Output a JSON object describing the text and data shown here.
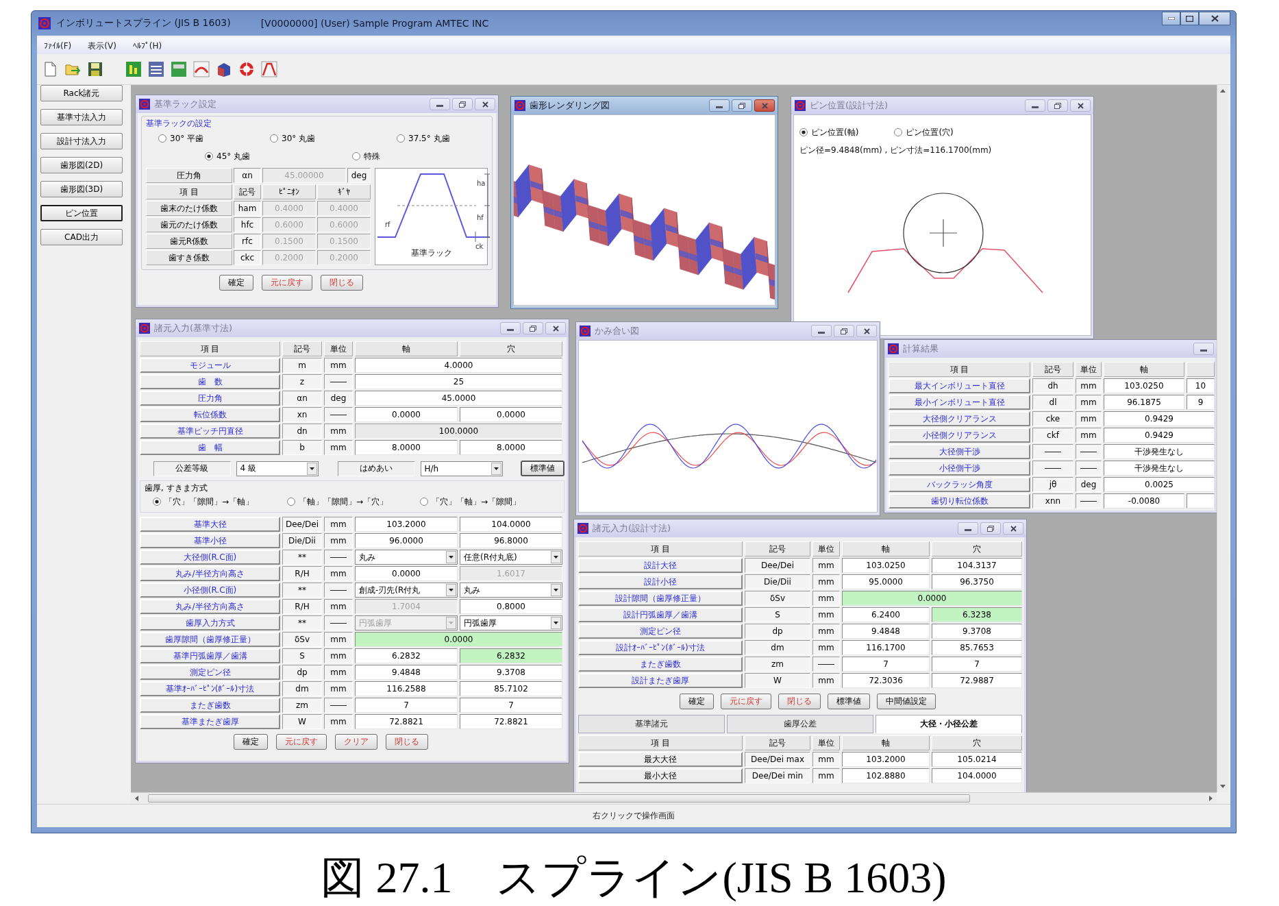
{
  "window": {
    "title": "インボリュートスプライン (JIS B 1603)",
    "subtitle": "[V0000000]  (User)  Sample Program  AMTEC INC"
  },
  "menu": [
    "ﾌｧｲﾙ(F)",
    "表示(V)",
    "ﾍﾙﾌﾟ(H)"
  ],
  "sidebar": [
    {
      "label": "Rack諸元",
      "selected": false
    },
    {
      "label": "基準寸法入力",
      "selected": false
    },
    {
      "label": "設計寸法入力",
      "selected": false
    },
    {
      "label": "歯形図(2D)",
      "selected": false
    },
    {
      "label": "歯形図(3D)",
      "selected": false
    },
    {
      "label": "ピン位置",
      "selected": true
    },
    {
      "label": "CAD出力",
      "selected": false
    }
  ],
  "windows": [
    {
      "kind": "rack",
      "title": "基準ラック設定",
      "active": false,
      "cut_off": false,
      "group_label": "基準ラックの設定",
      "radios": [
        {
          "label": "30° 平歯",
          "selected": false
        },
        {
          "label": "30° 丸歯",
          "selected": false
        },
        {
          "label": "37.5° 丸歯",
          "selected": false
        },
        {
          "label": "45° 丸歯",
          "selected": true
        },
        {
          "label": "特殊",
          "selected": false
        }
      ],
      "pressure_angle": {
        "label": "圧力角",
        "symbol": "αn",
        "value": "45.00000",
        "unit": "deg",
        "disabled": true
      },
      "columns": [
        "項 目",
        "記号",
        "ﾋﾟﾆｵﾝ",
        "ｷﾞﾔ"
      ],
      "rows": [
        {
          "label": "歯末のたけ係数",
          "symbol": "ham",
          "values": [
            "0.4000",
            "0.4000"
          ],
          "disabled": true
        },
        {
          "label": "歯元のたけ係数",
          "symbol": "hfc",
          "values": [
            "0.6000",
            "0.6000"
          ],
          "disabled": true
        },
        {
          "label": "歯元R係数",
          "symbol": "rfc",
          "values": [
            "0.1500",
            "0.1500"
          ],
          "disabled": true
        },
        {
          "label": "歯すき係数",
          "symbol": "ckc",
          "values": [
            "0.2000",
            "0.2000"
          ],
          "disabled": true
        }
      ],
      "diagram": {
        "labels": [
          "ha",
          "hf",
          "rf",
          "ck"
        ],
        "caption": "基準ラック"
      },
      "buttons": [
        {
          "label": "確定",
          "kind": "normal"
        },
        {
          "label": "元に戻す",
          "kind": "warn"
        },
        {
          "label": "閉じる",
          "kind": "warn"
        }
      ]
    },
    {
      "kind": "render",
      "title": "歯形レンダリング図",
      "active": true,
      "cut_off": false
    },
    {
      "kind": "pin",
      "title": "ピン位置(設計寸法)",
      "active": false,
      "cut_off": false,
      "radios": [
        {
          "label": "ピン位置(軸)",
          "selected": true
        },
        {
          "label": "ピン位置(穴)",
          "selected": false
        }
      ],
      "info": "ピン径=9.4848(mm) , ピン寸法=116.1700(mm)"
    },
    {
      "kind": "base_input",
      "title": "諸元入力(基準寸法)",
      "active": false,
      "cut_off": false,
      "columns": [
        "項 目",
        "記号",
        "単位",
        "軸",
        "穴"
      ],
      "rows": [
        {
          "label": "モジュール",
          "symbol": "m",
          "unit": "mm",
          "cells": [
            {
              "value": "4.0000",
              "kind": "field"
            }
          ]
        },
        {
          "label": "歯　数",
          "symbol": "z",
          "unit": "――",
          "cells": [
            {
              "value": "25",
              "kind": "field"
            }
          ]
        },
        {
          "label": "圧力角",
          "symbol": "αn",
          "unit": "deg",
          "cells": [
            {
              "value": "45.0000",
              "kind": "field"
            }
          ]
        },
        {
          "label": "転位係数",
          "symbol": "xn",
          "unit": "――",
          "cells": [
            {
              "value": "0.0000",
              "kind": "field"
            },
            {
              "value": "0.0000",
              "kind": "field"
            }
          ]
        },
        {
          "label": "基準ピッチ円直径",
          "symbol": "dn",
          "unit": "mm",
          "cells": [
            {
              "value": "100.0000",
              "kind": "readonly"
            }
          ]
        },
        {
          "label": "歯　幅",
          "symbol": "b",
          "unit": "mm",
          "cells": [
            {
              "value": "8.0000",
              "kind": "field"
            },
            {
              "value": "8.0000",
              "kind": "field"
            }
          ]
        }
      ],
      "tolerance": {
        "label": "公差等級",
        "grade": "4 級",
        "fit_label": "はめあい",
        "fit": "H/h",
        "button": "標準値"
      },
      "method": {
        "label": "歯厚, すきま方式",
        "options": [
          {
            "label": "「穴」「隙間」→「軸」",
            "selected": true
          },
          {
            "label": "「軸」「隙間」→「穴」",
            "selected": false
          },
          {
            "label": "「穴」「軸」→「隙間」",
            "selected": false
          }
        ]
      },
      "rows_2": [
        {
          "label": "基準大径",
          "symbol": "Dee/Dei",
          "unit": "mm",
          "cells": [
            {
              "value": "103.2000",
              "kind": "field"
            },
            {
              "value": "104.0000",
              "kind": "field"
            }
          ]
        },
        {
          "label": "基準小径",
          "symbol": "Die/Dii",
          "unit": "mm",
          "cells": [
            {
              "value": "96.0000",
              "kind": "field"
            },
            {
              "value": "96.8000",
              "kind": "field"
            }
          ]
        },
        {
          "label": "大径側(R.C面)",
          "symbol": "**",
          "unit": "――",
          "cells": [
            {
              "value": "丸み",
              "kind": "select"
            },
            {
              "value": "任意(R付丸底)",
              "kind": "select"
            }
          ]
        },
        {
          "label": "丸み/半径方向高さ",
          "symbol": "R/H",
          "unit": "mm",
          "cells": [
            {
              "value": "0.0000",
              "kind": "field"
            },
            {
              "value": "1.6017",
              "kind": "disabled"
            }
          ]
        },
        {
          "label": "小径側(R.C面)",
          "symbol": "**",
          "unit": "――",
          "cells": [
            {
              "value": "創成-刃先(R付丸",
              "kind": "select"
            },
            {
              "value": "丸み",
              "kind": "select"
            }
          ]
        },
        {
          "label": "丸み/半径方向高さ",
          "symbol": "R/H",
          "unit": "mm",
          "cells": [
            {
              "value": "1.7004",
              "kind": "disabled"
            },
            {
              "value": "0.8000",
              "kind": "field"
            }
          ]
        },
        {
          "label": "歯厚入力方式",
          "symbol": "**",
          "unit": "――",
          "cells": [
            {
              "value": "円弧歯厚",
              "kind": "select_disabled"
            },
            {
              "value": "円弧歯厚",
              "kind": "select"
            }
          ]
        },
        {
          "label": "歯厚隙間（歯厚修正量）",
          "symbol": "δSv",
          "unit": "mm",
          "cells": [
            {
              "value": "0.0000",
              "kind": "highlight"
            }
          ]
        },
        {
          "label": "基準円弧歯厚／歯溝",
          "symbol": "S",
          "unit": "mm",
          "cells": [
            {
              "value": "6.2832",
              "kind": "field"
            },
            {
              "value": "6.2832",
              "kind": "highlight"
            }
          ]
        },
        {
          "label": "測定ピン径",
          "symbol": "dp",
          "unit": "mm",
          "cells": [
            {
              "value": "9.4848",
              "kind": "field"
            },
            {
              "value": "9.3708",
              "kind": "field"
            }
          ]
        },
        {
          "label": "基準ｵｰﾊﾞｰﾋﾟﾝ(ﾎﾞｰﾙ)寸法",
          "symbol": "dm",
          "unit": "mm",
          "cells": [
            {
              "value": "116.2588",
              "kind": "field"
            },
            {
              "value": "85.7102",
              "kind": "field"
            }
          ]
        },
        {
          "label": "またぎ歯数",
          "symbol": "zm",
          "unit": "――",
          "cells": [
            {
              "value": "7",
              "kind": "field"
            },
            {
              "value": "7",
              "kind": "field"
            }
          ]
        },
        {
          "label": "基準またぎ歯厚",
          "symbol": "W",
          "unit": "mm",
          "cells": [
            {
              "value": "72.8821",
              "kind": "field"
            },
            {
              "value": "72.8821",
              "kind": "field"
            }
          ]
        }
      ],
      "buttons": [
        {
          "label": "確定",
          "kind": "normal"
        },
        {
          "label": "元に戻す",
          "kind": "warn"
        },
        {
          "label": "クリア",
          "kind": "warn"
        },
        {
          "label": "閉じる",
          "kind": "warn"
        }
      ]
    },
    {
      "kind": "mesh",
      "title": "かみ合い図",
      "active": false,
      "cut_off": false
    },
    {
      "kind": "result",
      "title": "計算結果",
      "active": false,
      "cut_off": true,
      "columns": [
        "項 目",
        "記号",
        "単位",
        "軸"
      ],
      "rows": [
        {
          "label": "最大インボリュート直径",
          "symbol": "dh",
          "unit": "mm",
          "cells": [
            {
              "value": "103.0250",
              "kind": "field"
            },
            {
              "value": "10",
              "kind": "field"
            }
          ]
        },
        {
          "label": "最小インボリュート直径",
          "symbol": "dl",
          "unit": "mm",
          "cells": [
            {
              "value": "96.1875",
              "kind": "field"
            },
            {
              "value": "9",
              "kind": "field"
            }
          ]
        },
        {
          "label": "大径側クリアランス",
          "symbol": "cke",
          "unit": "mm",
          "cells": [
            {
              "value": "0.9429",
              "kind": "field"
            }
          ]
        },
        {
          "label": "小径側クリアランス",
          "symbol": "ckf",
          "unit": "mm",
          "cells": [
            {
              "value": "0.9429",
              "kind": "field"
            }
          ]
        },
        {
          "label": "大径側干渉",
          "symbol": "――",
          "unit": "――",
          "cells": [
            {
              "value": "干渉発生なし",
              "kind": "field"
            }
          ]
        },
        {
          "label": "小径側干渉",
          "symbol": "――",
          "unit": "――",
          "cells": [
            {
              "value": "干渉発生なし",
              "kind": "field"
            }
          ]
        },
        {
          "label": "バックラッシ角度",
          "symbol": "jθ",
          "unit": "deg",
          "cells": [
            {
              "value": "0.0025",
              "kind": "field"
            }
          ]
        },
        {
          "label": "歯切り転位係数",
          "symbol": "xnn",
          "unit": "――",
          "cells": [
            {
              "value": "-0.0080",
              "kind": "field"
            },
            {
              "kind": "field"
            }
          ]
        }
      ]
    },
    {
      "kind": "design_input",
      "title": "諸元入力(設計寸法)",
      "active": false,
      "cut_off": false,
      "columns": [
        "項 目",
        "記号",
        "単位",
        "軸",
        "穴"
      ],
      "rows": [
        {
          "label": "設計大径",
          "symbol": "Dee/Dei",
          "unit": "mm",
          "cells": [
            {
              "value": "103.0250",
              "kind": "field"
            },
            {
              "value": "104.3137",
              "kind": "field"
            }
          ]
        },
        {
          "label": "設計小径",
          "symbol": "Die/Dii",
          "unit": "mm",
          "cells": [
            {
              "value": "95.0000",
              "kind": "field"
            },
            {
              "value": "96.3750",
              "kind": "field"
            }
          ]
        },
        {
          "label": "設計隙間（歯厚修正量）",
          "symbol": "δSv",
          "unit": "mm",
          "cells": [
            {
              "value": "0.0000",
              "kind": "highlight"
            }
          ]
        },
        {
          "label": "設計円弧歯厚／歯溝",
          "symbol": "S",
          "unit": "mm",
          "cells": [
            {
              "value": "6.2400",
              "kind": "field"
            },
            {
              "value": "6.3238",
              "kind": "highlight"
            }
          ]
        },
        {
          "label": "測定ピン径",
          "symbol": "dp",
          "unit": "mm",
          "cells": [
            {
              "value": "9.4848",
              "kind": "field"
            },
            {
              "value": "9.3708",
              "kind": "field"
            }
          ]
        },
        {
          "label": "設計ｵｰﾊﾞｰﾋﾟﾝ(ﾎﾞｰﾙ)寸法",
          "symbol": "dm",
          "unit": "mm",
          "cells": [
            {
              "value": "116.1700",
              "kind": "field"
            },
            {
              "value": "85.7653",
              "kind": "field"
            }
          ]
        },
        {
          "label": "またぎ歯数",
          "symbol": "zm",
          "unit": "――",
          "cells": [
            {
              "value": "7",
              "kind": "field"
            },
            {
              "value": "7",
              "kind": "field"
            }
          ]
        },
        {
          "label": "設計またぎ歯厚",
          "symbol": "W",
          "unit": "mm",
          "cells": [
            {
              "value": "72.3036",
              "kind": "field"
            },
            {
              "value": "72.9887",
              "kind": "field"
            }
          ]
        }
      ],
      "buttons": [
        {
          "label": "確定",
          "kind": "normal"
        },
        {
          "label": "元に戻す",
          "kind": "warn"
        },
        {
          "label": "閉じる",
          "kind": "warn"
        },
        {
          "label": "標準値",
          "kind": "normal"
        },
        {
          "label": "中間値設定",
          "kind": "normal"
        }
      ],
      "tabs": [
        {
          "label": "基準諸元",
          "selected": false
        },
        {
          "label": "歯厚公差",
          "selected": false
        },
        {
          "label": "大径・小径公差",
          "selected": true
        }
      ],
      "tab_columns": [
        "項 目",
        "記号",
        "単位",
        "軸",
        "穴"
      ],
      "tab_rows": [
        {
          "label": "最大大径",
          "symbol": "Dee/Dei max",
          "unit": "mm",
          "cells": [
            {
              "value": "103.2000",
              "kind": "field"
            },
            {
              "value": "105.0214",
              "kind": "field"
            }
          ]
        },
        {
          "label": "最小大径",
          "symbol": "Dee/Dei min",
          "unit": "mm",
          "cells": [
            {
              "value": "102.8880",
              "kind": "field"
            },
            {
              "value": "104.0000",
              "kind": "field"
            }
          ]
        }
      ]
    }
  ],
  "status_bar": "右クリックで操作画面",
  "caption": "図 27.1　スプライン(JIS B 1603)"
}
